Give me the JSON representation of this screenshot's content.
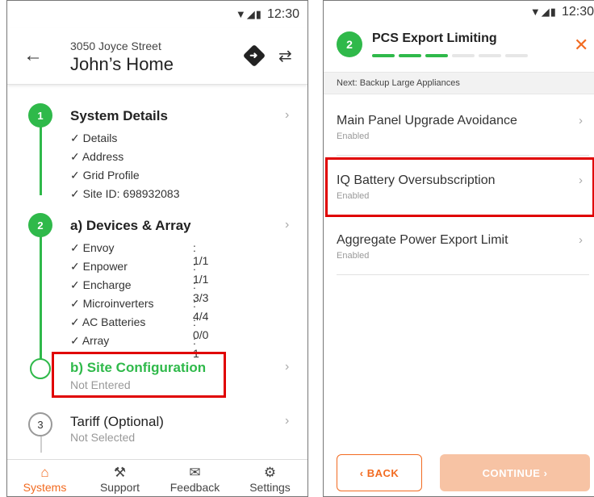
{
  "left": {
    "status": {
      "time": "12:30",
      "icons": "▼◢▮"
    },
    "header": {
      "address": "3050 Joyce Street",
      "home": "John’s Home",
      "back_icon": "←",
      "swap_icon": "⇄"
    },
    "steps": [
      {
        "num": "1",
        "title": "System Details",
        "items": [
          "✓ Details",
          "✓ Address",
          "✓ Grid Profile",
          "✓ Site ID: 698932083"
        ]
      },
      {
        "num": "2",
        "title": "a) Devices & Array",
        "items": [
          {
            "label": "✓ Envoy",
            "value": ": 1/1"
          },
          {
            "label": "✓ Enpower",
            "value": ": 1/1"
          },
          {
            "label": "✓ Encharge",
            "value": ": 3/3"
          },
          {
            "label": "✓ Microinverters",
            "value": ": 4/4"
          },
          {
            "label": "✓ AC Batteries",
            "value": ": 0/0"
          },
          {
            "label": "✓ Array",
            "value": ": 1"
          }
        ]
      },
      {
        "title": "b) Site Configuration",
        "status": "Not Entered"
      },
      {
        "num": "3",
        "title": "Tariff (Optional)",
        "status": "Not Selected"
      }
    ],
    "chevron": "›",
    "tabs": [
      {
        "label": "Systems",
        "icon": "⌂"
      },
      {
        "label": "Support",
        "icon": "⚒"
      },
      {
        "label": "Feedback",
        "icon": "✉"
      },
      {
        "label": "Settings",
        "icon": "⚙"
      }
    ]
  },
  "right": {
    "status": {
      "time": "12:30",
      "icons": "▼◢▮"
    },
    "step_num": "2",
    "title": "PCS Export Limiting",
    "progress": {
      "done": 3,
      "total": 6
    },
    "close_icon": "✕",
    "next_label": "Next: Backup Large Appliances",
    "items": [
      {
        "title": "Main Panel Upgrade Avoidance",
        "status": "Enabled"
      },
      {
        "title": "IQ Battery Oversubscription",
        "status": "Enabled"
      },
      {
        "title": "Aggregate Power Export Limit",
        "status": "Enabled"
      }
    ],
    "back_button": "‹  BACK",
    "continue_button": "CONTINUE  ›"
  },
  "colors": {
    "accent": "#f26b21",
    "success": "#2fb94a",
    "highlight": "#e00000"
  }
}
